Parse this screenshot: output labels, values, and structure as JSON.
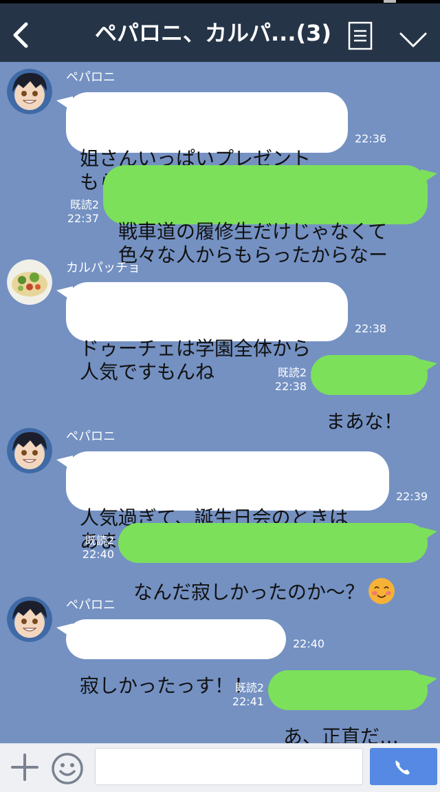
{
  "header": {
    "back_icon": "chevron-left-icon",
    "title": "ペパロニ、カルパ...(3)",
    "menu_icon": "list-icon",
    "collapse_icon": "chevron-down-icon",
    "background": "#263448"
  },
  "chat": {
    "background": "#7491c2",
    "incoming_bubble_color": "#ffffff",
    "outgoing_bubble_color": "#7ce05a",
    "messages": [
      {
        "dir": "in",
        "sender": "ペパロニ",
        "text": "姐さんいっぱいプレゼント\nもらってましたね！",
        "time": "22:36"
      },
      {
        "dir": "out",
        "read": "既読2",
        "text": "戦車道の履修生だけじゃなくて\n色々な人からもらったからなー",
        "time": "22:37"
      },
      {
        "dir": "in",
        "sender": "カルパッチョ",
        "text": "ドゥーチェは学園全体から\n人気ですもんね",
        "time": "22:38"
      },
      {
        "dir": "out",
        "read": "既読2",
        "text": "まあな！",
        "time": "22:38"
      },
      {
        "dir": "in",
        "sender": "ペパロニ",
        "text": "人気過ぎて、誕生日会のときは\nあまり話せなかったっすけどね",
        "time": "22:39"
      },
      {
        "dir": "out",
        "read": "既読2",
        "text": "なんだ寂しかったのか～？",
        "emoji": "smiling-face-icon",
        "time": "22:40"
      },
      {
        "dir": "in",
        "sender": "ペパロニ",
        "text": "寂しかったっす！！",
        "time": "22:40"
      },
      {
        "dir": "out",
        "read": "既読2",
        "text": "あ、正直だ…",
        "time": "22:41"
      }
    ]
  },
  "input_bar": {
    "plus_icon": "plus-icon",
    "sticker_icon": "smiley-icon",
    "message_value": "",
    "call_icon": "phone-icon",
    "call_color": "#5589e3"
  }
}
